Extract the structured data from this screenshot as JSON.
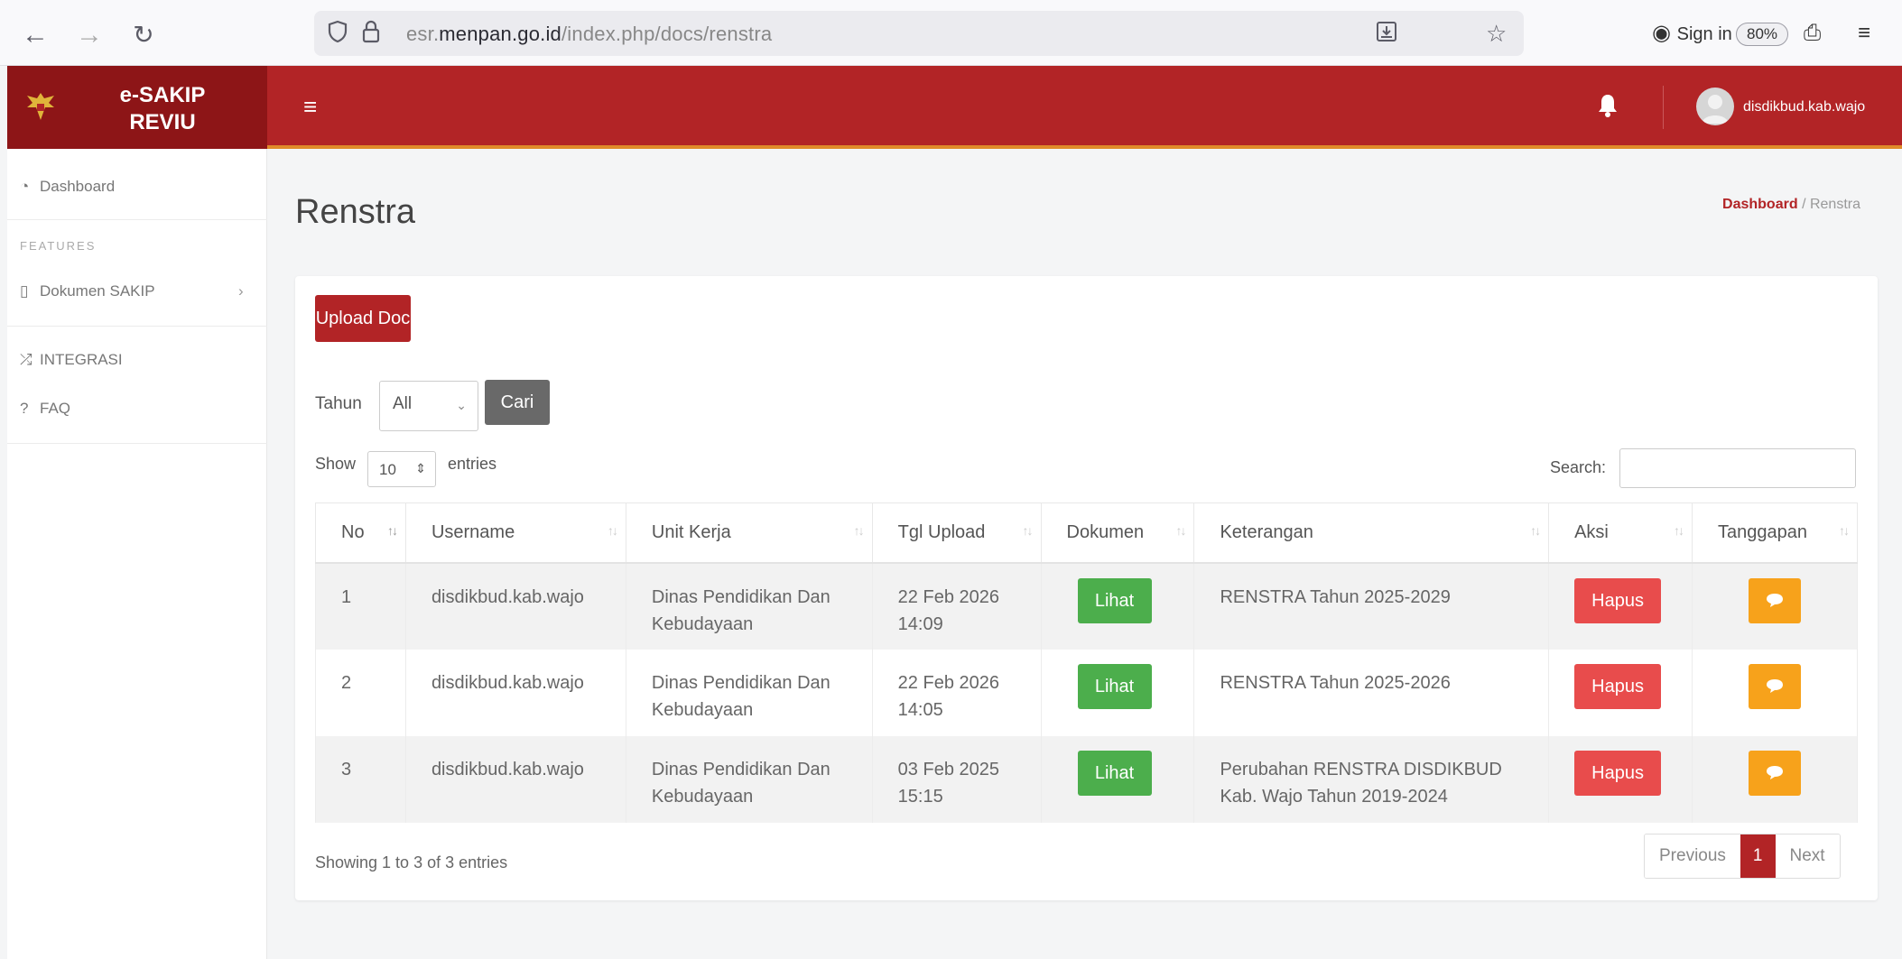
{
  "browser": {
    "url_prefix": "esr.",
    "url_domain": "menpan.go.id",
    "url_path": "/index.php/docs/renstra",
    "zoom": "80%",
    "sign_in": "Sign in"
  },
  "brand": {
    "line1": "e-SAKIP",
    "line2": "REVIU"
  },
  "topbar": {
    "username": "disdikbud.kab.wajo"
  },
  "sidebar": {
    "dashboard": "Dashboard",
    "caption": "FEATURES",
    "dokumen": "Dokumen SAKIP",
    "integrasi": "INTEGRASI",
    "faq": "FAQ"
  },
  "page": {
    "title": "Renstra",
    "crumb_home": "Dashboard",
    "crumb_sep": "/",
    "crumb_current": "Renstra"
  },
  "controls": {
    "upload": "Upload Doc",
    "tahun_label": "Tahun",
    "tahun_value": "All",
    "cari": "Cari",
    "show": "Show",
    "length": "10",
    "entries": "entries",
    "search": "Search:"
  },
  "table": {
    "headers": [
      "No",
      "Username",
      "Unit Kerja",
      "Tgl Upload",
      "Dokumen",
      "Keterangan",
      "Aksi",
      "Tanggapan"
    ],
    "rows": [
      {
        "no": "1",
        "username": "disdikbud.kab.wajo",
        "unit1": "Dinas Pendidikan Dan",
        "unit2": "Kebudayaan",
        "tgl1": "22 Feb 2026",
        "tgl2": "14:09",
        "dokumen": "Lihat",
        "ket1": "RENSTRA Tahun 2025-2029",
        "ket2": "",
        "aksi": "Hapus"
      },
      {
        "no": "2",
        "username": "disdikbud.kab.wajo",
        "unit1": "Dinas Pendidikan Dan",
        "unit2": "Kebudayaan",
        "tgl1": "22 Feb 2026",
        "tgl2": "14:05",
        "dokumen": "Lihat",
        "ket1": "RENSTRA Tahun 2025-2026",
        "ket2": "",
        "aksi": "Hapus"
      },
      {
        "no": "3",
        "username": "disdikbud.kab.wajo",
        "unit1": "Dinas Pendidikan Dan",
        "unit2": "Kebudayaan",
        "tgl1": "03 Feb 2025",
        "tgl2": "15:15",
        "dokumen": "Lihat",
        "ket1": "Perubahan RENSTRA DISDIKBUD",
        "ket2": "Kab. Wajo Tahun 2019-2024",
        "aksi": "Hapus"
      }
    ]
  },
  "footer": {
    "info": "Showing 1 to 3 of 3 entries",
    "previous": "Previous",
    "page": "1",
    "next": "Next"
  },
  "colors": {
    "brand_dark": "#8d1517",
    "brand": "#b22426",
    "accent_line": "#e08a2a",
    "success": "#4cae4c",
    "danger": "#e84c4c",
    "warning": "#f7a21b"
  },
  "icons": {
    "back": "arrow-left-icon",
    "forward": "arrow-right-icon",
    "reload": "reload-icon",
    "shield": "tracking-shield-icon",
    "lock": "lock-icon",
    "bell": "bell-icon",
    "chat": "comment-icon"
  }
}
